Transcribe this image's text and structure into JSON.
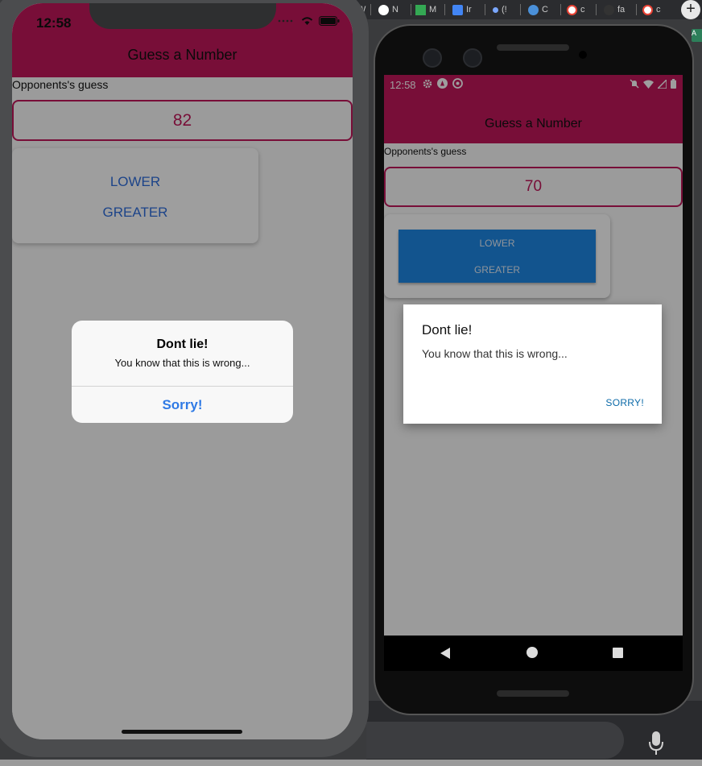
{
  "browser": {
    "tabs": [
      {
        "label": "W",
        "color": "#888888"
      },
      {
        "label": "N",
        "color": "#ffffff"
      },
      {
        "label": "M",
        "color": "#34a853"
      },
      {
        "label": "Ir",
        "color": "#4285f4"
      },
      {
        "label": "(!",
        "color": "#7aa7ff"
      },
      {
        "label": "C",
        "color": "#4a90d9"
      },
      {
        "label": "c",
        "color": "#ea4335"
      },
      {
        "label": "fa",
        "color": "#333333"
      },
      {
        "label": "c",
        "color": "#ea4335"
      }
    ],
    "new_tab_label": "+",
    "profile_badge": "A"
  },
  "ios": {
    "status_time": "12:58",
    "header_title": "Guess a Number",
    "opponent_label": "Opponents's guess",
    "guess_value": "82",
    "lower_label": "LOWER",
    "greater_label": "GREATER",
    "alert": {
      "title": "Dont lie!",
      "message": "You know that this is wrong...",
      "button": "Sorry!"
    }
  },
  "android": {
    "status_time": "12:58",
    "header_title": "Guess a Number",
    "opponent_label": "Opponents's guess",
    "guess_value": "70",
    "lower_label": "LOWER",
    "greater_label": "GREATER",
    "alert": {
      "title": "Dont lie!",
      "message": "You know that this is wrong...",
      "button": "SORRY!"
    }
  },
  "colors": {
    "primary": "#c2185b",
    "ios_button": "#2f6fde",
    "android_button_bg": "#1e88e5"
  }
}
